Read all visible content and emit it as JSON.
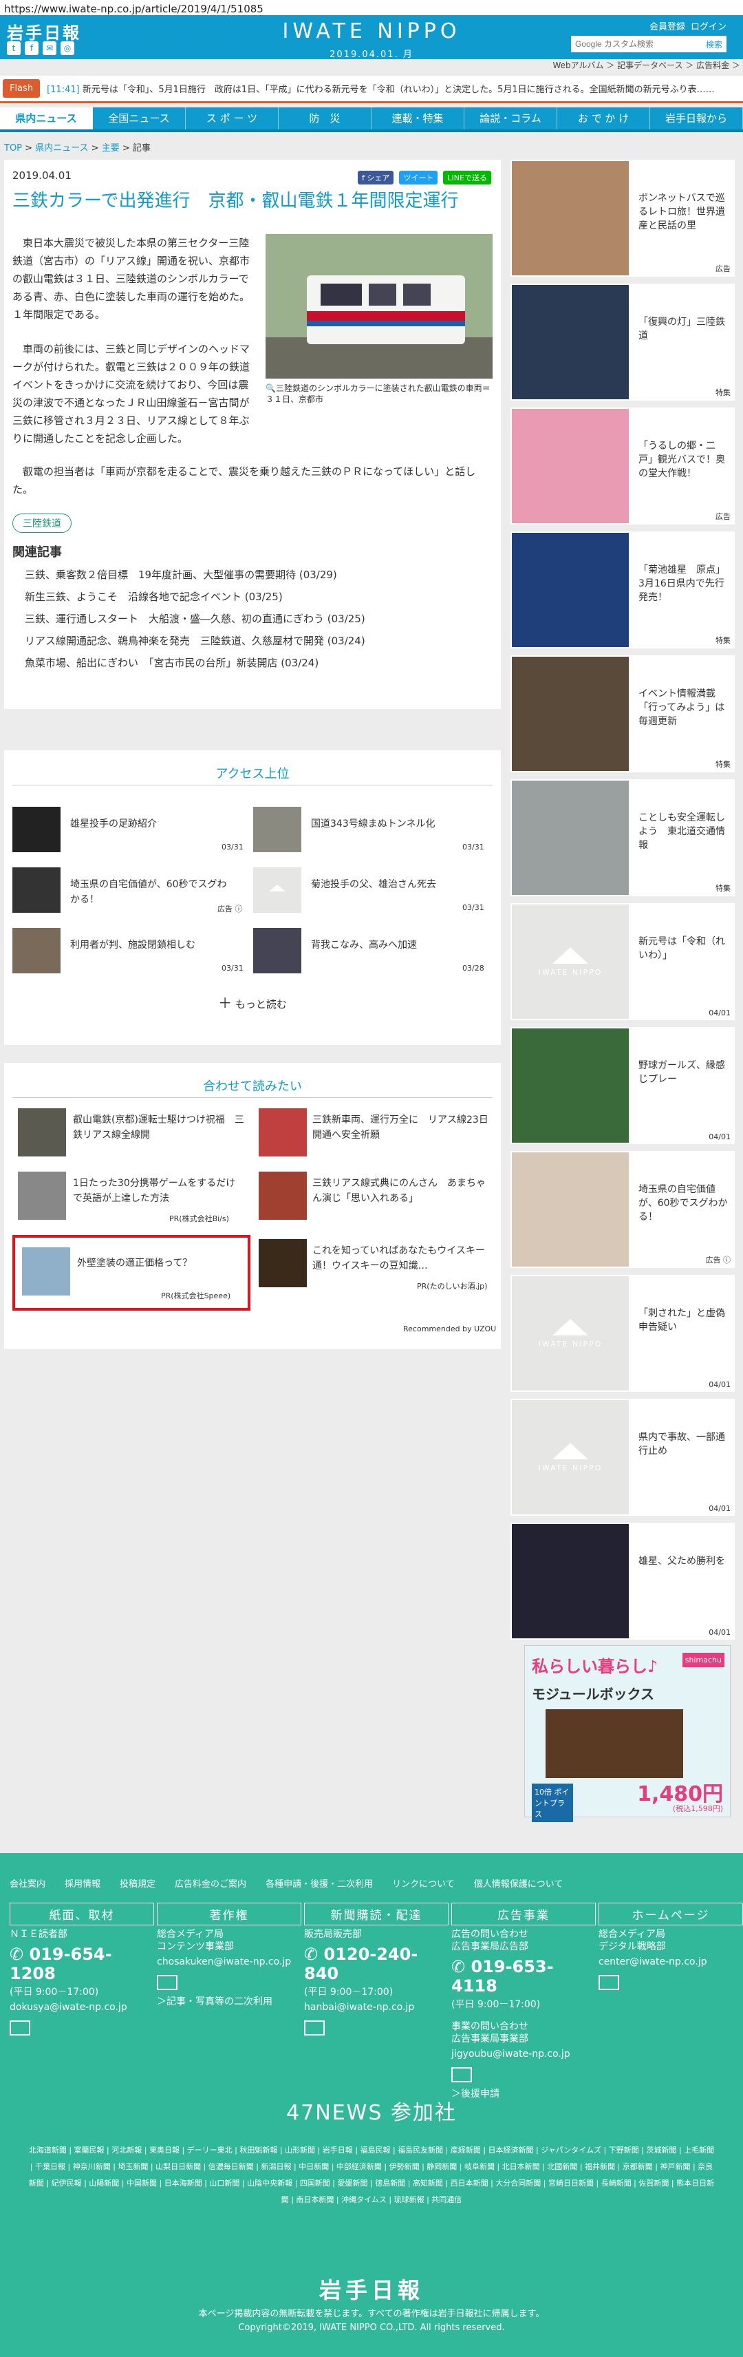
{
  "url": "https://www.iwate-np.co.jp/article/2019/4/1/51085",
  "header": {
    "logo": "岩手日報",
    "site": "IWATE NIPPO",
    "date": "2019.04.01. 月",
    "links": [
      "会員登録",
      "ログイン"
    ],
    "search_placeholder": "Google カスタム検索",
    "search_btn": "検索",
    "sublinks": "Webアルバム ＞ 記事データベース ＞ 広告料金 ＞",
    "social": [
      "t",
      "f",
      "✉",
      "◎"
    ]
  },
  "flash": {
    "label": "Flash",
    "time": "[11:41]",
    "text": "新元号は「令和」、5月1日施行　政府は1日、「平成」に代わる新元号を「令和（れいわ）」と決定した。5月1日に施行される。全国紙新聞の新元号ふり表……"
  },
  "nav": [
    "県内ニュース",
    "全国ニュース",
    "ス ポ ー ツ",
    "防　災",
    "連載・特集",
    "論説・コラム",
    "お で か け",
    "岩手日報から"
  ],
  "breadcrumb": {
    "top": "TOP",
    "sep": " > ",
    "pref": "県内ニュース",
    "main": "主要",
    "cur": "記事"
  },
  "article": {
    "date": "2019.04.01",
    "shares": [
      "f シェア",
      "ツイート",
      "LINEで送る"
    ],
    "title": "三鉄カラーで出発進行　京都・叡山電鉄１年間限定運行",
    "caption": "三陸鉄道のシンボルカラーに塗装された叡山電鉄の車両＝３１日、京都市",
    "p1": "　東日本大震災で被災した本県の第三セクター三陸鉄道（宮古市）の「リアス線」開通を祝い、京都市の叡山電鉄は３１日、三陸鉄道のシンボルカラーである青、赤、白色に塗装した車両の運行を始めた。１年間限定である。",
    "p2": "　車両の前後には、三鉄と同じデザインのヘッドマークが付けられた。叡電と三鉄は２００９年の鉄道イベントをきっかけに交流を続けており、今回は震災の津波で不通となったＪＲ山田線釜石－宮古間が三鉄に移管され３月２３日、リアス線として８年ぶりに開通したことを記念し企画した。",
    "p3": "　叡電の担当者は「車両が京都を走ることで、震災を乗り越えた三鉄のＰＲになってほしい」と話した。",
    "tag": "三陸鉄道",
    "rel_title": "関連記事",
    "related": [
      "三鉄、乗客数２倍目標　19年度計画、大型催事の需要期待 (03/29)",
      "新生三鉄、ようこそ　沿線各地で記念イベント (03/25)",
      "三鉄、運行通しスタート　大船渡・盛―久慈、初の直通にぎわう (03/25)",
      "リアス線開通記念、鵜鳥神楽を発売　三陸鉄道、久慈屋材で開発 (03/24)",
      "魚菜市場、船出にぎわい　「宮古市民の台所」新装開店 (03/24)"
    ]
  },
  "access": {
    "title": "アクセス上位",
    "items": [
      {
        "t": "雄星投手の足跡紹介",
        "d": "03/31"
      },
      {
        "t": "国道343号線まぬトンネル化",
        "d": "03/31"
      },
      {
        "t": "埼玉県の自宅価値が、60秒でスグわかる！",
        "d": "広告 ⓘ"
      },
      {
        "t": "菊池投手の父、雄治さん死去",
        "d": "03/31"
      },
      {
        "t": "利用者が判、施設閉鎖相しむ",
        "d": "03/31"
      },
      {
        "t": "背我こなみ、高みへ加速",
        "d": "03/28"
      }
    ],
    "more": "もっと読む"
  },
  "recommend": {
    "title": "合わせて読みたい",
    "items": [
      {
        "t": "叡山電鉄(京都)運転士駆けつけ祝福　三鉄リアス線全線開",
        "s": ""
      },
      {
        "t": "三鉄新車両、運行万全に　リアス線23日開通へ安全祈願",
        "s": ""
      },
      {
        "t": "1日たった30分携帯ゲームをするだけで英語が上達した方法",
        "s": "PR(株式会社Bi/s)"
      },
      {
        "t": "三鉄リアス線式典にのんさん　あまちゃん演じ「思い入れある」",
        "s": ""
      },
      {
        "t": "外壁塗装の適正価格って？",
        "s": "PR(株式会社Speee)"
      },
      {
        "t": "これを知っていればあなたもウイスキー通！ウイスキーの豆知識…",
        "s": "PR(たのしいお酒.jp)"
      }
    ],
    "credit": "Recommended by UZOU"
  },
  "sidebar": [
    {
      "t": "ボンネットバスで巡るレトロ旅！世界遺産と民話の里",
      "d": "広告"
    },
    {
      "t": "「復興の灯」三陸鉄道",
      "d": "特集"
    },
    {
      "t": "「うるしの郷・二戸」観光バスで！奥の堂大作戦！",
      "d": "広告"
    },
    {
      "t": "「菊池雄星　原点」3月16日県内で先行発売！",
      "d": "特集"
    },
    {
      "t": "イベント情報満載「行ってみよう」は毎週更新",
      "d": "特集"
    },
    {
      "t": "ことしも安全運転しよう　東北道交通情報",
      "d": "特集"
    },
    {
      "t": "新元号は「令和（れいわ）」",
      "d": "04/01"
    },
    {
      "t": "野球ガールズ、縁感じプレー",
      "d": "04/01"
    },
    {
      "t": "埼玉県の自宅価値が、60秒でスグわかる！",
      "d": "広告 ⓘ"
    },
    {
      "t": "「刺された」と虚偽申告疑い",
      "d": "04/01"
    },
    {
      "t": "県内で事故、一部通行止め",
      "d": "04/01"
    },
    {
      "t": "雄星、父ため勝利を",
      "d": "04/01"
    }
  ],
  "ph_label": "IWATE NIPPO",
  "ad": {
    "t1": "私らしい暮らし♪",
    "t2": "モジュールボックス",
    "price": "1,480円",
    "tax": "(税込1,598円)",
    "pts": "10倍 ポイントプラス",
    "brand": "shimachu"
  },
  "footer": {
    "links": [
      "会社案内",
      "採用情報",
      "投稿規定",
      "広告料金のご案内",
      "各種申請・後援・二次利用",
      "リンクについて",
      "個人情報保護について"
    ],
    "cols": [
      {
        "h": "紙面、取材",
        "b": "ＮＩＥ読者部",
        "tel": "019-654-1208",
        "hours": "(平日 9:00－17:00)",
        "mail": "dokusya@iwate-np.co.jp"
      },
      {
        "h": "著作権",
        "b": "総合メディア局\nコンテンツ事業部",
        "mail": "chosakuken@iwate-np.co.jp",
        "link": "＞記事・写真等の二次利用"
      },
      {
        "h": "新聞購読・配達",
        "b": "販売局販売部",
        "tel": "0120-240-840",
        "hours": "(平日 9:00－17:00)",
        "mail": "hanbai@iwate-np.co.jp"
      },
      {
        "h": "広告事業",
        "b": "広告の問い合わせ\n広告事業局広告部",
        "tel": "019-653-4118",
        "hours": "(平日 9:00－17:00)",
        "b2": "事業の問い合わせ\n広告事業局事業部",
        "mail": "jigyoubu@iwate-np.co.jp",
        "link": "＞後援申請"
      },
      {
        "h": "ホームページ",
        "b": "総合メディア局\nデジタル戦略部",
        "mail": "center@iwate-np.co.jp"
      }
    ],
    "news_title": "47NEWS 参加社",
    "news": "北海道新聞 | 室蘭民報 | 河北新報 | 東奥日報 | デーリー東北 | 秋田魁新報 | 山形新聞 | 岩手日報 | 福島民報 | 福島民友新聞 | 産経新聞 | 日本経済新聞 | ジャパンタイムズ | 下野新聞 | 茨城新聞 | 上毛新聞 | 千葉日報 | 神奈川新聞 | 埼玉新聞 | 山梨日日新聞 | 信濃毎日新聞 | 新潟日報 | 中日新聞 | 中部経済新聞 | 伊勢新聞 | 静岡新聞 | 岐阜新聞 | 北日本新聞 | 北國新聞 | 福井新聞 | 京都新聞 | 神戸新聞 | 奈良新聞 | 紀伊民報 | 山陽新聞 | 中国新聞 | 日本海新聞 | 山口新聞 | 山陰中央新報 | 四国新聞 | 愛媛新聞 | 徳島新聞 | 高知新聞 | 西日本新聞 | 大分合同新聞 | 宮崎日日新聞 | 長崎新聞 | 佐賀新聞 | 熊本日日新聞 | 南日本新聞 | 沖縄タイムス | 琉球新報 | 共同通信",
    "logo": "岩手日報",
    "copy1": "本ページ掲載内容の無断転載を禁じます。すべての著作権は岩手日報社に帰属します。",
    "copy2": "Copyright©2019, IWATE NIPPO CO.,LTD. All rights reserved."
  }
}
